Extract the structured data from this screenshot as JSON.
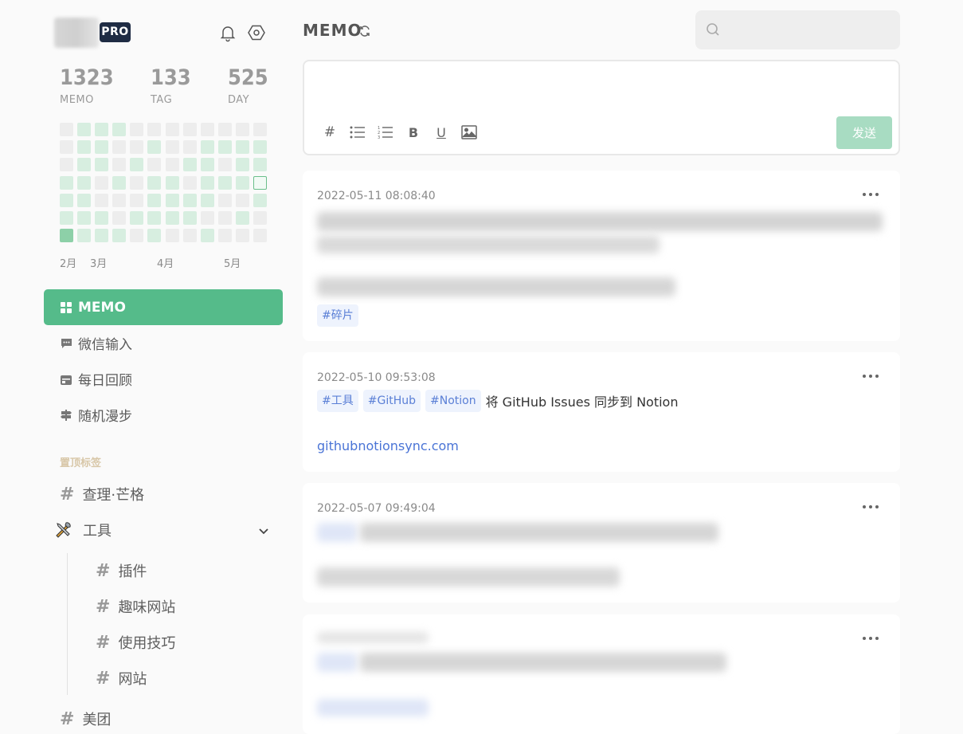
{
  "header": {
    "title": "MEMO",
    "search": {
      "placeholder": "",
      "value": ""
    },
    "user": {
      "badge": "PRO"
    }
  },
  "stats": [
    {
      "value": "1323",
      "label": "MEMO"
    },
    {
      "value": "133",
      "label": "TAG"
    },
    {
      "value": "525",
      "label": "DAY"
    }
  ],
  "heatmap": {
    "rows": [
      [
        0,
        1,
        1,
        1,
        0,
        0,
        0,
        0,
        0,
        0,
        0,
        0
      ],
      [
        0,
        1,
        1,
        0,
        0,
        1,
        0,
        0,
        1,
        1,
        1,
        1
      ],
      [
        0,
        1,
        1,
        0,
        1,
        0,
        0,
        1,
        1,
        0,
        1,
        1
      ],
      [
        1,
        1,
        0,
        1,
        0,
        1,
        1,
        0,
        1,
        1,
        1,
        "today"
      ],
      [
        1,
        1,
        0,
        0,
        0,
        1,
        1,
        1,
        1,
        0,
        0,
        1
      ],
      [
        1,
        1,
        1,
        0,
        1,
        1,
        1,
        1,
        0,
        0,
        1,
        0
      ],
      [
        3,
        1,
        1,
        1,
        0,
        1,
        0,
        0,
        1,
        0,
        0,
        0
      ]
    ],
    "months": [
      "2月",
      "3月",
      "4月",
      "5月"
    ]
  },
  "nav": {
    "items": [
      {
        "label": "MEMO",
        "icon": "grid-icon",
        "active": true
      },
      {
        "label": "微信输入",
        "icon": "chat-icon",
        "active": false
      },
      {
        "label": "每日回顾",
        "icon": "calendar-icon",
        "active": false
      },
      {
        "label": "随机漫步",
        "icon": "signpost-icon",
        "active": false
      }
    ]
  },
  "pinned": {
    "title": "置顶标签",
    "tags": [
      {
        "label": "查理·芒格",
        "level": 0
      },
      {
        "label": "工具",
        "level": 0,
        "icon": "tools-emoji",
        "expanded": true
      },
      {
        "label": "插件",
        "level": 1
      },
      {
        "label": "趣味网站",
        "level": 1
      },
      {
        "label": "使用技巧",
        "level": 1
      },
      {
        "label": "网站",
        "level": 1
      },
      {
        "label": "美团",
        "level": 0
      }
    ]
  },
  "editor": {
    "placeholder": "",
    "toolbar": [
      "hashtag-icon",
      "bullet-list-icon",
      "numbered-list-icon",
      "bold-icon",
      "underline-icon",
      "image-icon"
    ],
    "tool_glyphs": {
      "hashtag": "#",
      "bold": "B",
      "underline": "U"
    },
    "send_label": "发送"
  },
  "memos": [
    {
      "time": "2022-05-11 08:08:40",
      "tags": [
        "#碎片"
      ],
      "text": "",
      "link": "",
      "content_blurred": true
    },
    {
      "time": "2022-05-10 09:53:08",
      "tags": [
        "#工具",
        "#GitHub",
        "#Notion"
      ],
      "text": "将 GitHub Issues 同步到 Notion",
      "link": "githubnotionsync.com",
      "content_blurred": false
    },
    {
      "time": "2022-05-07 09:49:04",
      "tags": [],
      "text": "",
      "link": "",
      "content_blurred": true
    },
    {
      "time": "",
      "tags": [],
      "text": "",
      "link": "",
      "content_blurred": true
    }
  ],
  "colors": {
    "accent": "#55bb8a",
    "send_disabled": "#a8dcc2",
    "pro_badge": "#1f2c44",
    "tag_bg": "#eef3fd",
    "tag_text": "#5a7fd6",
    "link": "#4a74d6",
    "section_title": "#d8c7a8"
  }
}
